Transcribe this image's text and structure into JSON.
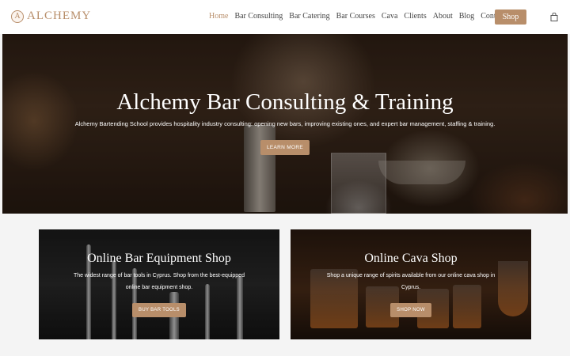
{
  "brand": {
    "name": "ALCHEMY",
    "mark": "A",
    "accent_color": "#b88e6a"
  },
  "nav": {
    "items": [
      {
        "label": "Home",
        "active": true
      },
      {
        "label": "Bar Consulting"
      },
      {
        "label": "Bar Catering"
      },
      {
        "label": "Bar Courses"
      },
      {
        "label": "Cava"
      },
      {
        "label": "Clients"
      },
      {
        "label": "About"
      },
      {
        "label": "Blog"
      },
      {
        "label": "Contact"
      }
    ],
    "shop_label": "Shop",
    "cart_icon": "shopping-bag-icon"
  },
  "hero": {
    "title": "Alchemy Bar Consulting & Training",
    "subtitle": "Alchemy Bartending School provides hospitality industry consulting: opening new bars, improving existing ones, and expert bar management, staffing & training.",
    "button": "LEARN MORE"
  },
  "cards": [
    {
      "title": "Online Bar Equipment Shop",
      "desc_line1": "The widest range of bar tools in Cyprus. Shop from the best-equipped",
      "desc_line2": "online bar equipment shop.",
      "button": "BUY BAR TOOLS"
    },
    {
      "title": "Online Cava Shop",
      "desc_line1": "Shop a unique range of spirits available from our online cava shop in",
      "desc_line2": "Cyprus.",
      "button": "SHOP NOW"
    }
  ]
}
